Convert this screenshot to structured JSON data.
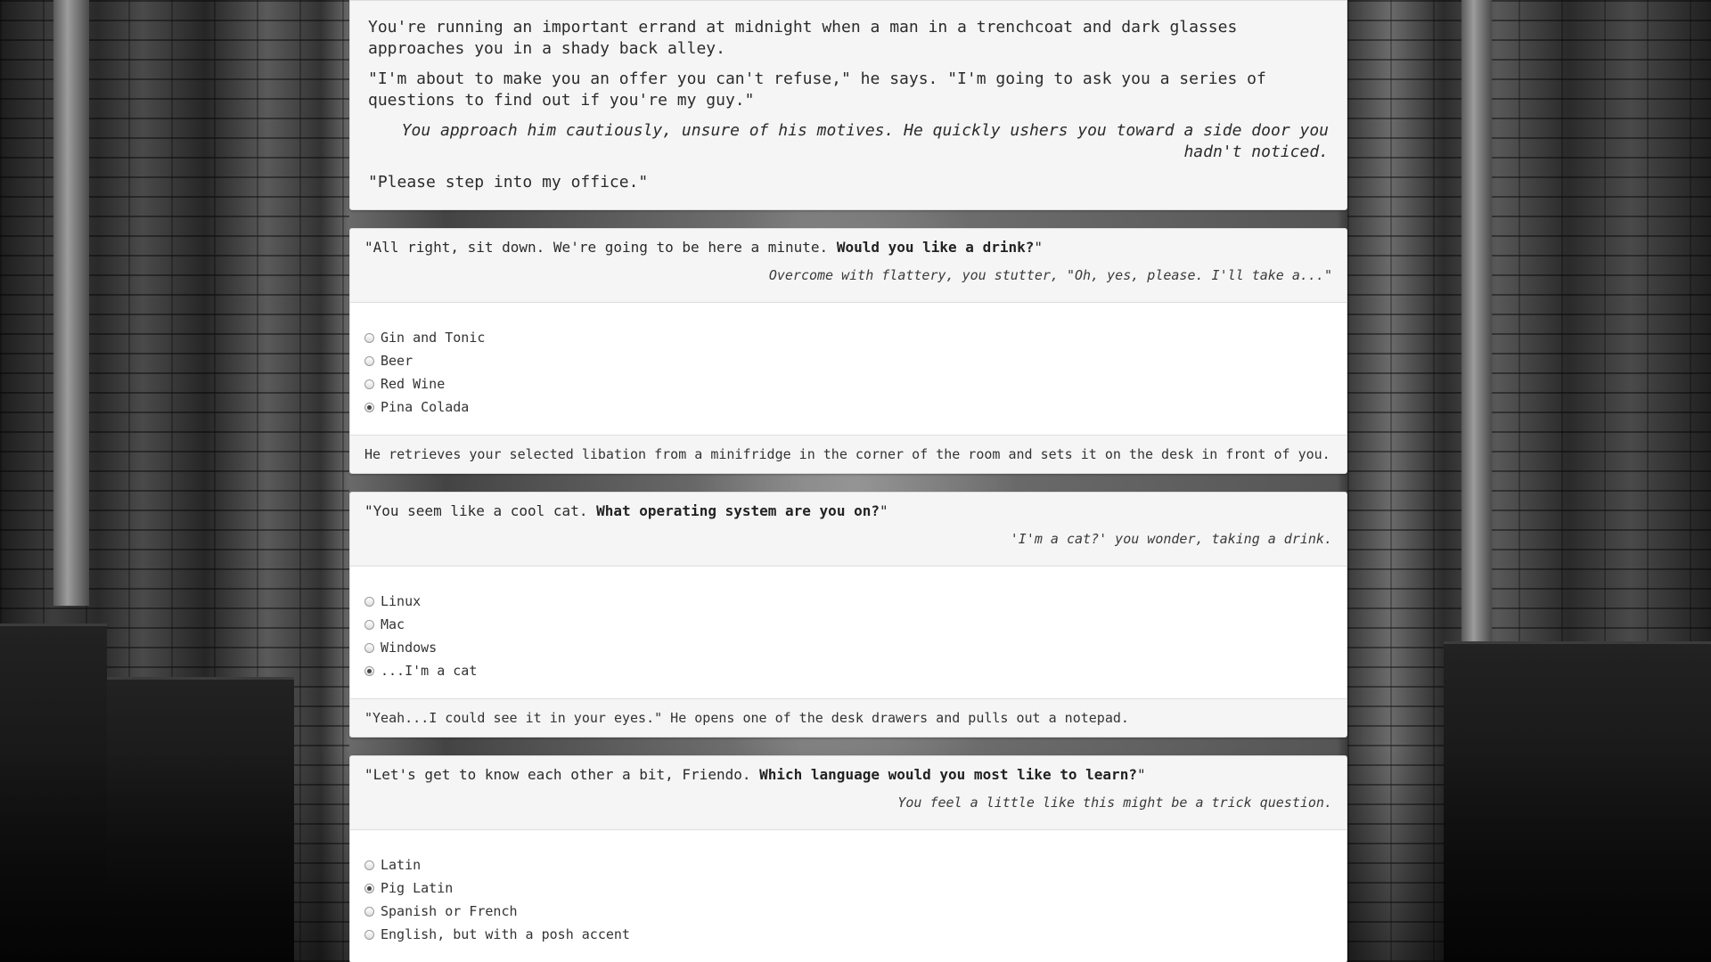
{
  "intro": {
    "paragraph1": "You're running an important errand at midnight when a man in a trenchcoat and dark glasses approaches you in a shady back alley.",
    "paragraph2": "\"I'm about to make you an offer you can't refuse,\" he says. \"I'm going to ask you a series of questions to find out if you're my guy.\"",
    "aside": "You approach him cautiously, unsure of his motives. He quickly ushers you toward a side door you hadn't noticed.",
    "paragraph3": "\"Please step into my office.\""
  },
  "questions": [
    {
      "prompt_lead": "\"All right, sit down. We're going to be here a minute. ",
      "prompt_bold": "Would you like a drink?",
      "prompt_tail": "\"",
      "reaction": "Overcome with flattery, you stutter, \"Oh, yes, please. I'll take a...\"",
      "options": [
        {
          "label": "Gin and Tonic",
          "checked": false
        },
        {
          "label": "Beer",
          "checked": false
        },
        {
          "label": "Red Wine",
          "checked": false
        },
        {
          "label": "Pina Colada",
          "checked": true
        }
      ],
      "response": "He retrieves your selected libation from a minifridge in the corner of the room and sets it on the desk in front of you."
    },
    {
      "prompt_lead": "\"You seem like a cool cat. ",
      "prompt_bold": "What operating system are you on?",
      "prompt_tail": "\"",
      "reaction": "'I'm a cat?' you wonder, taking a drink.",
      "options": [
        {
          "label": "Linux",
          "checked": false
        },
        {
          "label": "Mac",
          "checked": false
        },
        {
          "label": "Windows",
          "checked": false
        },
        {
          "label": "...I'm a cat",
          "checked": true
        }
      ],
      "response": "\"Yeah...I could see it in your eyes.\" He opens one of the desk drawers and pulls out a notepad."
    },
    {
      "prompt_lead": "\"Let's get to know each other a bit, Friendo. ",
      "prompt_bold": "Which language would you most like to learn?",
      "prompt_tail": "\"",
      "reaction": "You feel a little like this might be a trick question.",
      "options": [
        {
          "label": "Latin",
          "checked": false
        },
        {
          "label": "Pig Latin",
          "checked": true
        },
        {
          "label": "Spanish or French",
          "checked": false
        },
        {
          "label": "English, but with a posh accent",
          "checked": false
        }
      ]
    }
  ]
}
